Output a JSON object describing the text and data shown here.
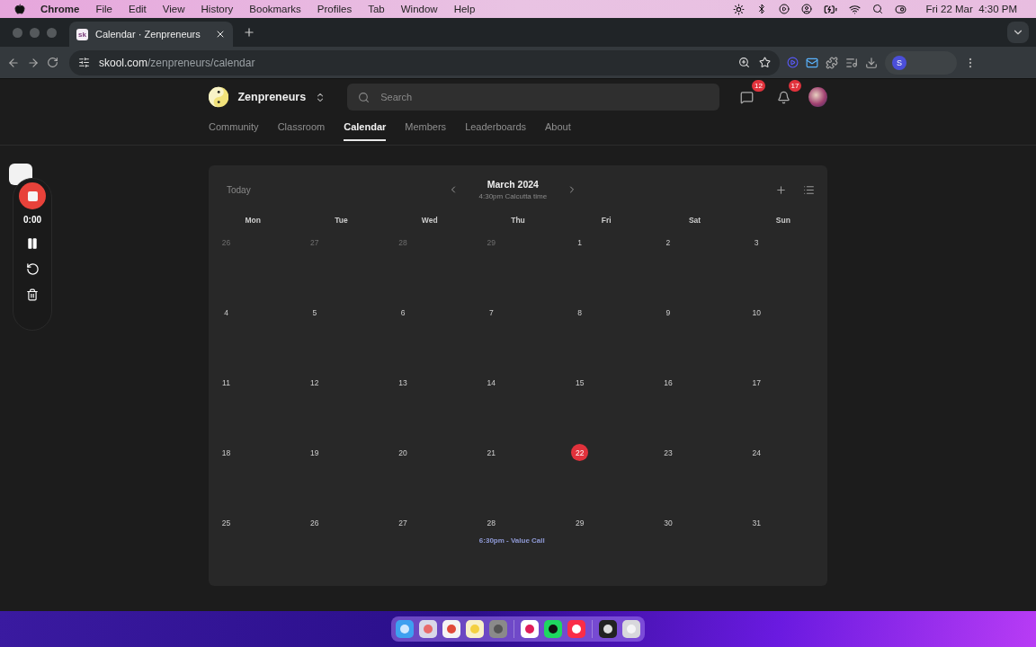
{
  "menubar": {
    "app": "Chrome",
    "menus": [
      "File",
      "Edit",
      "View",
      "History",
      "Bookmarks",
      "Profiles",
      "Tab",
      "Window",
      "Help"
    ],
    "clock": "Fri 22 Mar  4:30 PM"
  },
  "browser": {
    "tab_favicon": "sk",
    "tab_title": "Calendar · Zenpreneurs",
    "url_host": "skool.com",
    "url_path": "/zenpreneurs/calendar",
    "profile_initial": "S"
  },
  "site": {
    "community": "Zenpreneurs",
    "search": {
      "placeholder": "Search"
    },
    "chat_badge": "12",
    "notification_badge": "17",
    "nav": [
      {
        "label": "Community",
        "selected": false
      },
      {
        "label": "Classroom",
        "selected": false
      },
      {
        "label": "Calendar",
        "selected": true
      },
      {
        "label": "Members",
        "selected": false
      },
      {
        "label": "Leaderboards",
        "selected": false
      },
      {
        "label": "About",
        "selected": false
      }
    ]
  },
  "recorder": {
    "time": "0:00"
  },
  "calendar": {
    "today_button": "Today",
    "month": "March 2024",
    "timezone": "4:30pm Calcutta time",
    "weekdays": [
      "Mon",
      "Tue",
      "Wed",
      "Thu",
      "Fri",
      "Sat",
      "Sun"
    ],
    "weeks": [
      {
        "days": [
          {
            "day": "26",
            "outside": true,
            "today": false
          },
          {
            "day": "27",
            "outside": true,
            "today": false
          },
          {
            "day": "28",
            "outside": true,
            "today": false
          },
          {
            "day": "29",
            "outside": true,
            "today": false
          },
          {
            "day": "1",
            "outside": false,
            "today": false
          },
          {
            "day": "2",
            "outside": false,
            "today": false
          },
          {
            "day": "3",
            "outside": false,
            "today": false
          }
        ]
      },
      {
        "days": [
          {
            "day": "4",
            "outside": false,
            "today": false
          },
          {
            "day": "5",
            "outside": false,
            "today": false
          },
          {
            "day": "6",
            "outside": false,
            "today": false
          },
          {
            "day": "7",
            "outside": false,
            "today": false
          },
          {
            "day": "8",
            "outside": false,
            "today": false
          },
          {
            "day": "9",
            "outside": false,
            "today": false
          },
          {
            "day": "10",
            "outside": false,
            "today": false
          }
        ]
      },
      {
        "days": [
          {
            "day": "11",
            "outside": false,
            "today": false
          },
          {
            "day": "12",
            "outside": false,
            "today": false
          },
          {
            "day": "13",
            "outside": false,
            "today": false
          },
          {
            "day": "14",
            "outside": false,
            "today": false
          },
          {
            "day": "15",
            "outside": false,
            "today": false
          },
          {
            "day": "16",
            "outside": false,
            "today": false
          },
          {
            "day": "17",
            "outside": false,
            "today": false
          }
        ]
      },
      {
        "days": [
          {
            "day": "18",
            "outside": false,
            "today": false
          },
          {
            "day": "19",
            "outside": false,
            "today": false
          },
          {
            "day": "20",
            "outside": false,
            "today": false
          },
          {
            "day": "21",
            "outside": false,
            "today": false
          },
          {
            "day": "22",
            "outside": false,
            "today": true
          },
          {
            "day": "23",
            "outside": false,
            "today": false
          },
          {
            "day": "24",
            "outside": false,
            "today": false
          }
        ]
      },
      {
        "days": [
          {
            "day": "25",
            "outside": false,
            "today": false
          },
          {
            "day": "26",
            "outside": false,
            "today": false
          },
          {
            "day": "27",
            "outside": false,
            "today": false
          },
          {
            "day": "28",
            "outside": false,
            "today": false,
            "events": [
              "6:30pm - Value Call"
            ]
          },
          {
            "day": "29",
            "outside": false,
            "today": false
          },
          {
            "day": "30",
            "outside": false,
            "today": false
          },
          {
            "day": "31",
            "outside": false,
            "today": false
          }
        ]
      }
    ]
  }
}
